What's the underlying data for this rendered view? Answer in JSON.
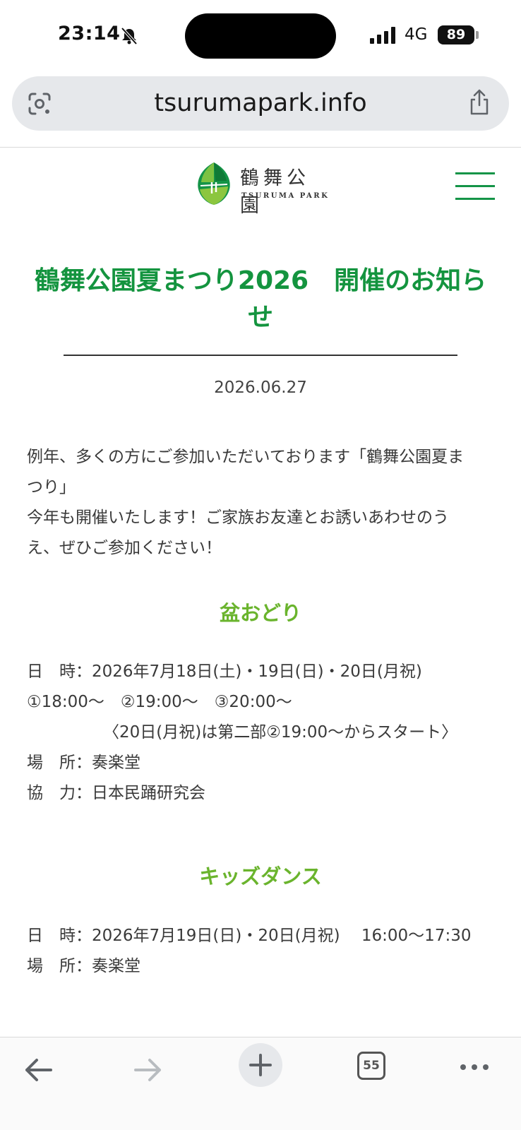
{
  "status_bar": {
    "time": "23:14",
    "network": "4G",
    "battery": "89"
  },
  "browser": {
    "url": "tsurumapark.info",
    "tab_count": "55"
  },
  "site": {
    "logo_jp": "鶴舞公園",
    "logo_en": "TSURUMA PARK",
    "brand_color": "#14943f"
  },
  "article": {
    "title": "鶴舞公園夏まつり2026　開催のお知らせ",
    "date": "2026.06.27",
    "intro_lines": [
      "例年、多くの方にご参加いただいております「鶴舞公園夏ま",
      "つり」",
      "今年も開催いたします！ご家族お友達とお誘いあわせのう",
      "え、ぜひご参加ください！"
    ]
  },
  "sections": [
    {
      "title": "盆おどり",
      "lines": [
        "日　時：2026年7月18日(土)・19日(日)・20日(月祝)",
        "①18:00～　②19:00～　③20:00～",
        "〈20日(月祝)は第二部②19:00～からスタート〉",
        "場　所：奏楽堂",
        "協　力：日本民踊研究会"
      ]
    },
    {
      "title": "キッズダンス",
      "lines": [
        "日　時：2026年7月19日(日)・20日(月祝)　 16:00～17:30",
        "場　所：奏楽堂"
      ]
    }
  ]
}
